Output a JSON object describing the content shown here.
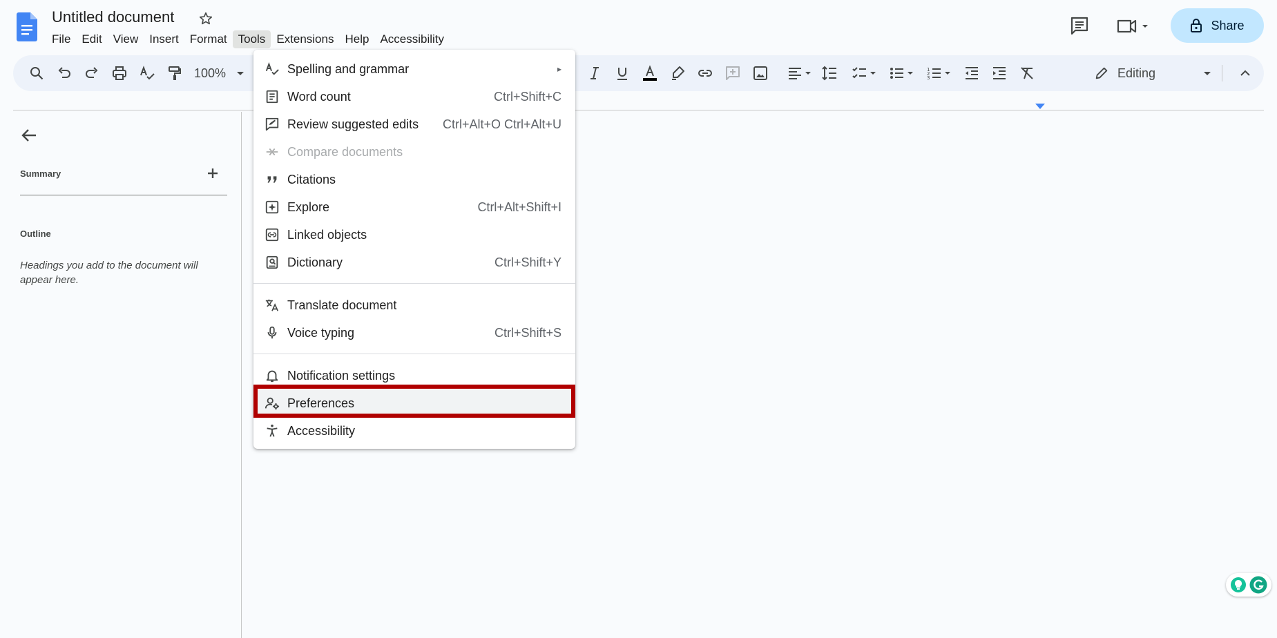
{
  "document": {
    "title": "Untitled document"
  },
  "menubar": [
    "File",
    "Edit",
    "View",
    "Insert",
    "Format",
    "Tools",
    "Extensions",
    "Help",
    "Accessibility"
  ],
  "header": {
    "share_label": "Share"
  },
  "toolbar": {
    "zoom": "100%",
    "mode": "Editing"
  },
  "sidebar": {
    "summary_label": "Summary",
    "outline_label": "Outline",
    "outline_hint": "Headings you add to the document will appear here."
  },
  "tools_menu": {
    "items": [
      {
        "label": "Spelling and grammar",
        "shortcut": "▸",
        "icon": "spellcheck-icon"
      },
      {
        "label": "Word count",
        "shortcut": "Ctrl+Shift+C",
        "icon": "word-count-icon"
      },
      {
        "label": "Review suggested edits",
        "shortcut": "Ctrl+Alt+O Ctrl+Alt+U",
        "icon": "review-edits-icon"
      },
      {
        "label": "Compare documents",
        "shortcut": "",
        "icon": "compare-icon",
        "disabled": true
      },
      {
        "label": "Citations",
        "shortcut": "",
        "icon": "quote-icon"
      },
      {
        "label": "Explore",
        "shortcut": "Ctrl+Alt+Shift+I",
        "icon": "explore-icon"
      },
      {
        "label": "Linked objects",
        "shortcut": "",
        "icon": "link-objects-icon"
      },
      {
        "label": "Dictionary",
        "shortcut": "Ctrl+Shift+Y",
        "icon": "dictionary-icon"
      },
      {
        "label": "Translate document",
        "shortcut": "",
        "icon": "translate-icon"
      },
      {
        "label": "Voice typing",
        "shortcut": "Ctrl+Shift+S",
        "icon": "mic-icon"
      },
      {
        "label": "Notification settings",
        "shortcut": "",
        "icon": "bell-icon"
      },
      {
        "label": "Preferences",
        "shortcut": "",
        "icon": "preferences-icon"
      },
      {
        "label": "Accessibility",
        "shortcut": "",
        "icon": "accessibility-icon"
      }
    ]
  },
  "colors": {
    "highlight_border": "#b00000",
    "share_bg": "#c2e7ff",
    "toolbar_bg": "#edf2fa"
  }
}
